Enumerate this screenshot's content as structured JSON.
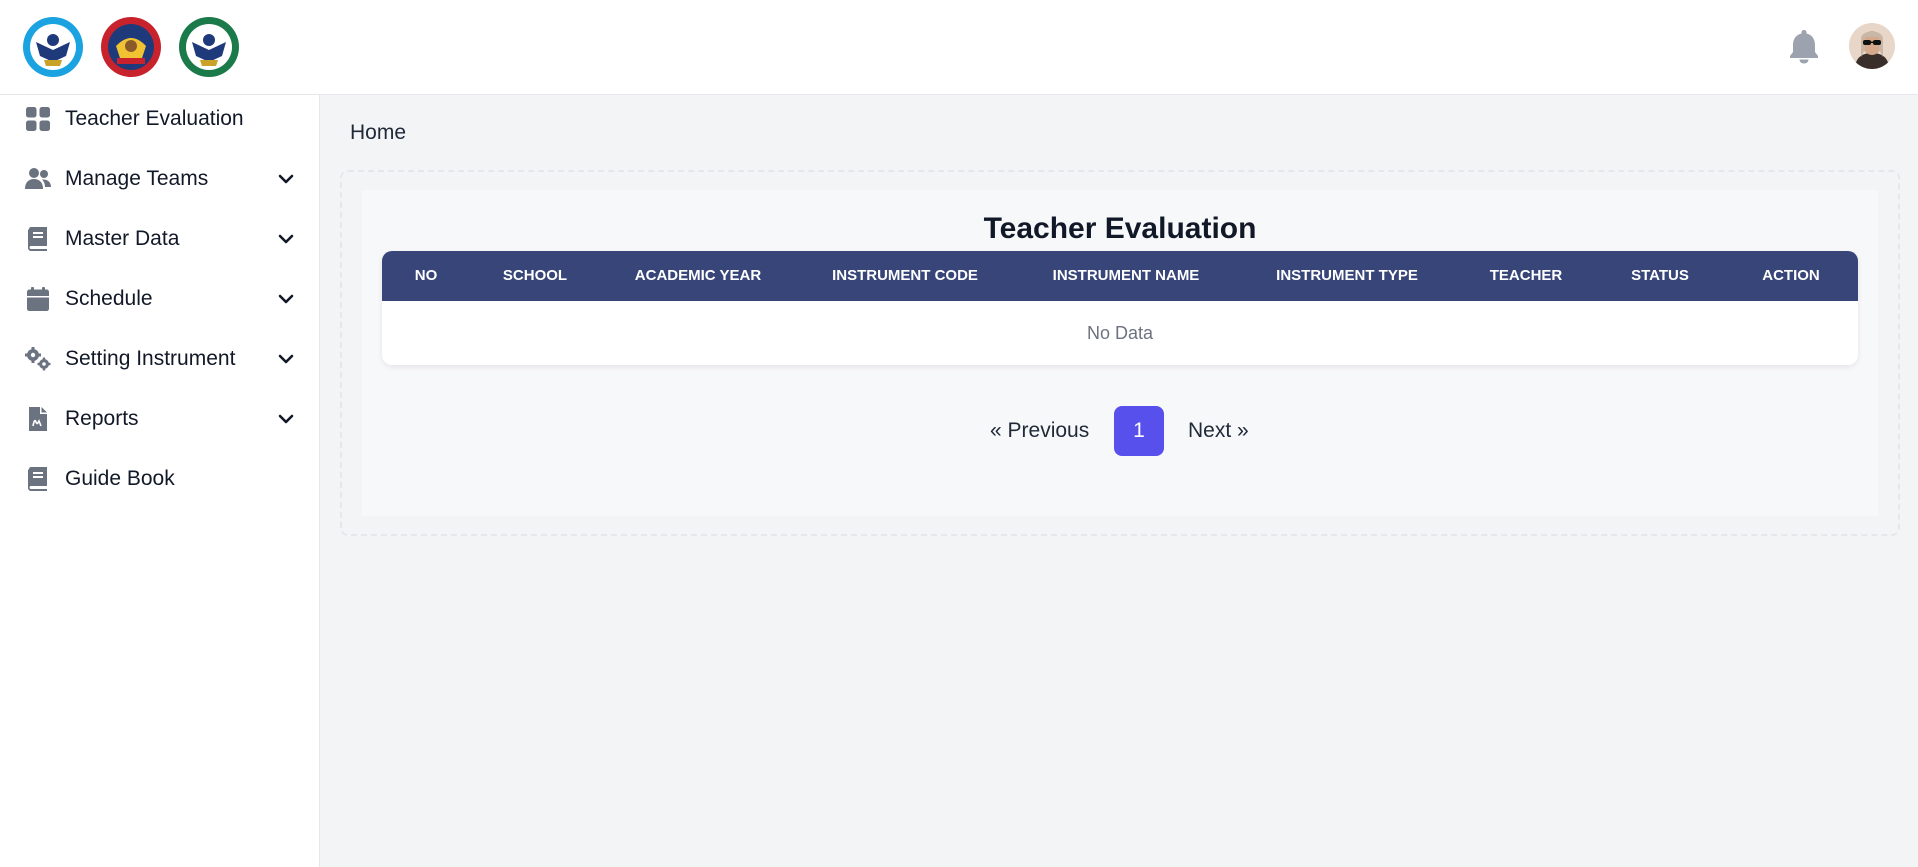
{
  "header": {
    "logos": [
      "school-crest-blue",
      "school-crest-red",
      "school-crest-green"
    ],
    "notification_icon": "bell-icon",
    "avatar_icon": "user-avatar"
  },
  "sidebar": {
    "items": [
      {
        "label": "Teacher Evaluation",
        "icon": "dashboard-grid-icon",
        "expandable": false
      },
      {
        "label": "Manage Teams",
        "icon": "users-icon",
        "expandable": true
      },
      {
        "label": "Master Data",
        "icon": "book-icon",
        "expandable": true
      },
      {
        "label": "Schedule",
        "icon": "calendar-icon",
        "expandable": true
      },
      {
        "label": "Setting Instrument",
        "icon": "gears-icon",
        "expandable": true
      },
      {
        "label": "Reports",
        "icon": "file-signature-icon",
        "expandable": true
      },
      {
        "label": "Guide Book",
        "icon": "book-icon",
        "expandable": false
      }
    ]
  },
  "breadcrumb": {
    "label": "Home"
  },
  "main": {
    "title": "Teacher Evaluation",
    "table": {
      "columns": [
        "NO",
        "SCHOOL",
        "ACADEMIC YEAR",
        "INSTRUMENT CODE",
        "INSTRUMENT NAME",
        "INSTRUMENT TYPE",
        "TEACHER",
        "STATUS",
        "ACTION"
      ],
      "empty_text": "No Data"
    },
    "pagination": {
      "previous_label": "« Previous",
      "current_page": "1",
      "next_label": "Next »"
    }
  },
  "colors": {
    "table_header": "#374579",
    "accent": "#5850ec",
    "icon_gray": "#6b7280"
  }
}
